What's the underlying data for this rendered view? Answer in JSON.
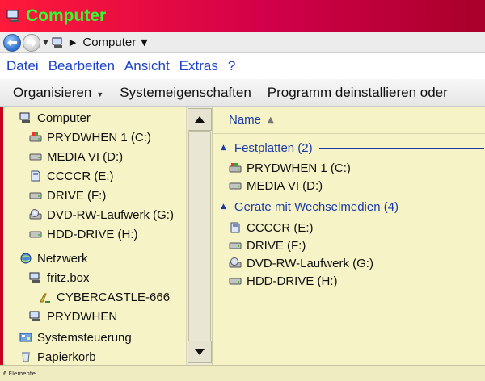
{
  "window": {
    "title": "Computer"
  },
  "address": {
    "location": "Computer"
  },
  "menu": [
    "Datei",
    "Bearbeiten",
    "Ansicht",
    "Extras",
    "?"
  ],
  "toolbar": [
    "Organisieren",
    "Systemeigenschaften",
    "Programm deinstallieren oder"
  ],
  "nav": {
    "items": [
      {
        "label": "Computer",
        "icon": "computer-icon"
      },
      {
        "label": "PRYDWHEN 1 (C:)",
        "icon": "system-drive-icon"
      },
      {
        "label": "MEDIA VI (D:)",
        "icon": "drive-icon"
      },
      {
        "label": "CCCCR (E:)",
        "icon": "memory-card-icon"
      },
      {
        "label": "DRIVE (F:)",
        "icon": "drive-icon"
      },
      {
        "label": "DVD-RW-Laufwerk (G:)",
        "icon": "dvd-drive-icon"
      },
      {
        "label": "HDD-DRIVE (H:)",
        "icon": "drive-icon"
      },
      {
        "label": "Netzwerk",
        "icon": "network-icon"
      },
      {
        "label": "fritz.box",
        "icon": "computer-icon"
      },
      {
        "label": "CYBERCASTLE-666",
        "icon": "shared-folder-icon"
      },
      {
        "label": "PRYDWHEN",
        "icon": "computer-icon"
      },
      {
        "label": "Systemsteuerung",
        "icon": "control-panel-icon"
      },
      {
        "label": "Papierkorb",
        "icon": "recycle-bin-icon"
      }
    ]
  },
  "content": {
    "column_header": "Name",
    "groups": [
      {
        "label": "Festplatten (2)",
        "items": [
          {
            "label": "PRYDWHEN 1 (C:)",
            "icon": "system-drive-icon"
          },
          {
            "label": "MEDIA VI (D:)",
            "icon": "drive-icon"
          }
        ]
      },
      {
        "label": "Geräte mit Wechselmedien (4)",
        "items": [
          {
            "label": "CCCCR (E:)",
            "icon": "memory-card-icon"
          },
          {
            "label": "DRIVE (F:)",
            "icon": "drive-icon"
          },
          {
            "label": "DVD-RW-Laufwerk (G:)",
            "icon": "dvd-drive-icon"
          },
          {
            "label": "HDD-DRIVE (H:)",
            "icon": "drive-icon"
          }
        ]
      }
    ]
  },
  "status": {
    "text": "6 Elemente"
  },
  "colors": {
    "title_bg": "#ff1a3a",
    "title_text": "#2fff2f",
    "menu_text": "#1b42c8",
    "pane_bg": "#f6f3c6",
    "group_accent": "#1b3aa8"
  }
}
